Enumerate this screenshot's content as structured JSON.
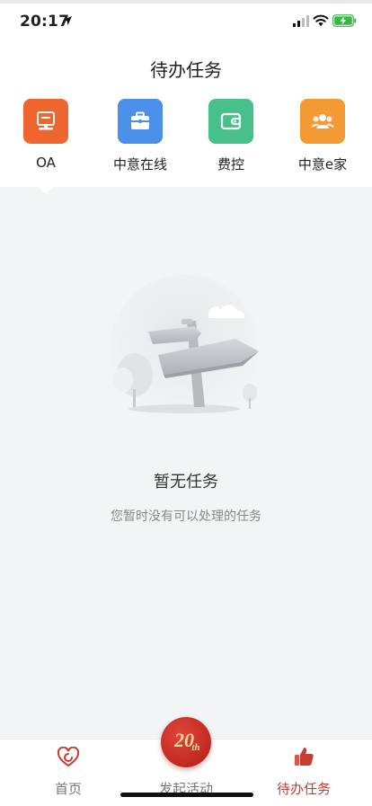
{
  "status_bar": {
    "time": "20:17"
  },
  "header": {
    "title": "待办任务"
  },
  "apps": [
    {
      "label": "OA",
      "color": "#ef6530",
      "icon": "monitor-icon"
    },
    {
      "label": "中意在线",
      "color": "#4a90e8",
      "icon": "briefcase-icon"
    },
    {
      "label": "费控",
      "color": "#47c089",
      "icon": "wallet-icon"
    },
    {
      "label": "中意e家",
      "color": "#f39a34",
      "icon": "people-icon"
    }
  ],
  "empty_state": {
    "title": "暂无任务",
    "description": "您暂时没有可以处理的任务"
  },
  "tabbar": {
    "home_label": "首页",
    "launch_label": "发起活动",
    "badge_text": "20",
    "badge_suffix": "th",
    "tasks_label": "待办任务",
    "active_color": "#c93b2f"
  }
}
